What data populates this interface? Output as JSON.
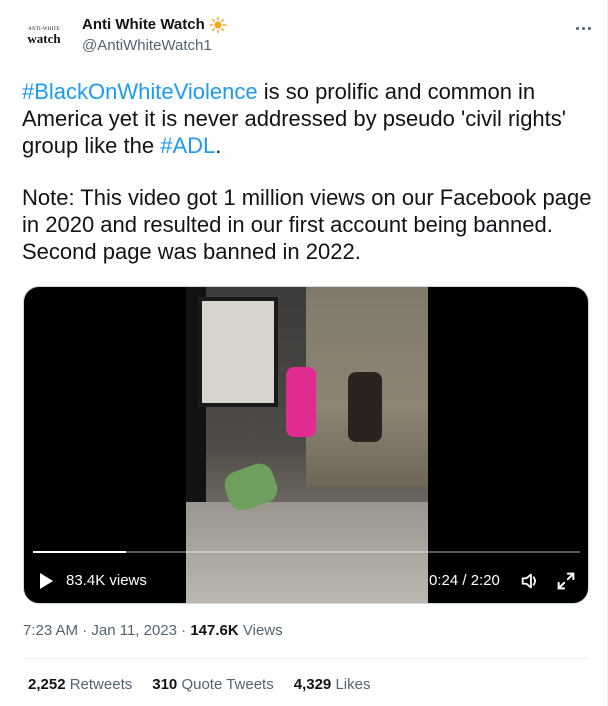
{
  "account": {
    "display_name": "Anti White Watch",
    "handle": "@AntiWhiteWatch1",
    "avatar_small_text": "ANTI-WHITE",
    "avatar_big_text": "watch",
    "name_emoji": "sun-icon"
  },
  "tweet": {
    "line1_tag": "#BlackOnWhiteViolence",
    "line1_rest": " is so prolific and common in America yet it is never addressed by pseudo 'civil rights' group like the ",
    "line1_tag2": "#ADL",
    "line1_end": ".",
    "line2": "Note: This video got 1 million views on our Facebook page in 2020 and resulted in our first account being banned. Second page was banned in 2022."
  },
  "video": {
    "views": "83.4K views",
    "time": "0:24 / 2:20",
    "progress": 0.17
  },
  "meta": {
    "timestamp": "7:23 AM · Jan 11, 2023",
    "separator": " · ",
    "view_count": "147.6K",
    "view_label": " Views"
  },
  "stats": {
    "retweets_count": "2,252",
    "retweets_label": " Retweets",
    "quotes_count": "310",
    "quotes_label": " Quote Tweets",
    "likes_count": "4,329",
    "likes_label": " Likes"
  },
  "colors": {
    "link": "#1d9bf0",
    "secondary_text": "#536471",
    "primary_text": "#0f1419"
  }
}
